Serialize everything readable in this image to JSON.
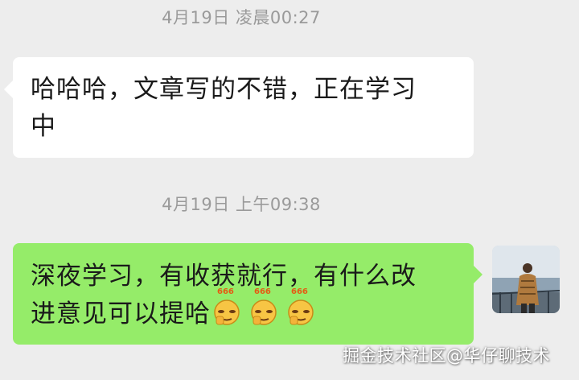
{
  "chat": {
    "timestamp_1": "4月19日 凌晨00:27",
    "message_1_line1": "哈哈哈，文章写的不错，正在学习",
    "message_1_line2": "中",
    "timestamp_2": "4月19日 上午09:38",
    "message_2_line1": "深夜学习，有收获就行，有什么改",
    "message_2_line2": "进意见可以提哈",
    "sticker_badge": "666"
  },
  "watermark": "掘金技术社区@华仔聊技术",
  "colors": {
    "background": "#ededed",
    "incoming_bubble": "#ffffff",
    "outgoing_bubble": "#95ec69",
    "timestamp": "#9a9a9a"
  },
  "icons": {
    "sticker": "thumbs-up-666-emoji",
    "avatar": "user-avatar-photo"
  }
}
